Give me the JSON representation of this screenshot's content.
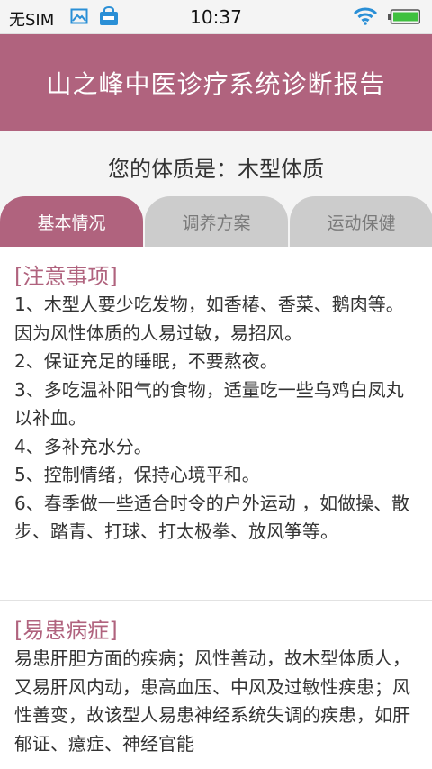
{
  "status_bar": {
    "carrier": "无SIM",
    "time": "10:37",
    "icons": [
      "image-icon",
      "shopping-bag-icon",
      "wifi-icon",
      "battery-icon"
    ]
  },
  "header": {
    "title": "山之峰中医诊疗系统诊断报告"
  },
  "constitution_line": "您的体质是：木型体质",
  "tabs": [
    {
      "label": "基本情况",
      "active": true
    },
    {
      "label": "调养方案",
      "active": false
    },
    {
      "label": "运动保健",
      "active": false
    }
  ],
  "sections": [
    {
      "title": "[注意事项]",
      "text": "1、木型人要少吃发物，如香椿、香菜、鹅肉等。因为风性体质的人易过敏，易招风。\n2、保证充足的睡眠，不要熬夜。\n3、多吃温补阳气的食物，适量吃一些乌鸡白凤丸以补血。\n4、多补充水分。\n5、控制情绪，保持心境平和。\n6、春季做一些适合时令的户外运动 ，如做操、散步、踏青、打球、打太极拳、放风筝等。"
    },
    {
      "title": "[易患病症]",
      "text": "易患肝胆方面的疾病；风性善动，故木型体质人，又易肝风内动，患高血压、中风及过敏性疾患；风性善变，故该型人易患神经系统失调的疾患，如肝郁证、癔症、神经官能"
    }
  ],
  "colors": {
    "accent": "#b0637e",
    "tab_inactive": "#cccccc",
    "background": "#f4f4f4"
  }
}
